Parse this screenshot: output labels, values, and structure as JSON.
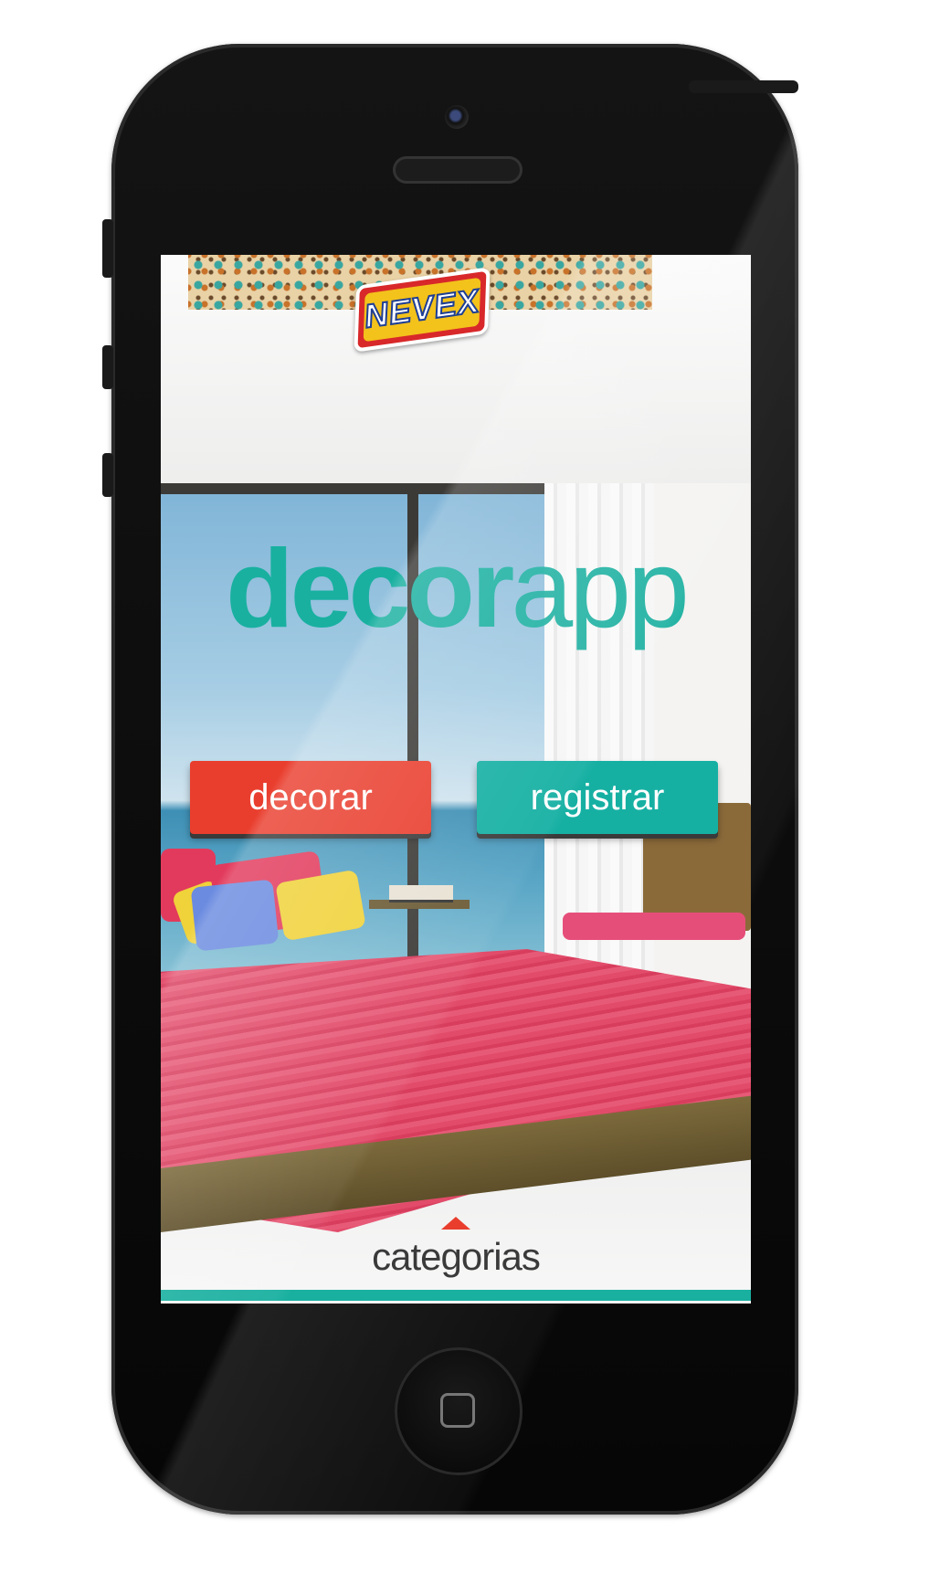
{
  "brand": {
    "logo_text": "NEVEX"
  },
  "app": {
    "title_bold": "decor",
    "title_light": "app"
  },
  "buttons": {
    "decorar_label": "decorar",
    "registrar_label": "registrar"
  },
  "footer": {
    "categorias_label": "categorias"
  },
  "colors": {
    "teal": "#19b0a0",
    "red": "#e93e2e"
  },
  "icons": [
    "home-button-icon",
    "arrow-up-icon"
  ]
}
